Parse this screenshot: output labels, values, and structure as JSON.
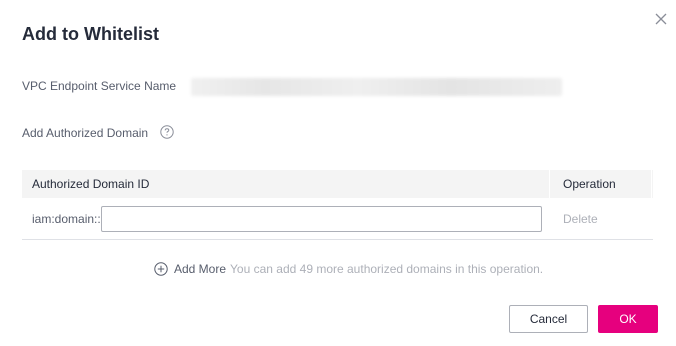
{
  "dialog": {
    "title": "Add to Whitelist"
  },
  "form": {
    "vpc_endpoint_label": "VPC Endpoint Service Name",
    "vpc_endpoint_value": "",
    "authorized_domain_label": "Add Authorized Domain"
  },
  "table": {
    "headers": [
      "Authorized Domain ID",
      "Operation"
    ],
    "rows": [
      {
        "prefix": "iam:domain::",
        "value": "",
        "action": "Delete"
      }
    ]
  },
  "add_more": {
    "link": "Add More",
    "hint": "You can add 49 more authorized domains in this operation."
  },
  "buttons": {
    "cancel": "Cancel",
    "ok": "OK"
  },
  "icons": {
    "close": "close-icon",
    "help": "question-circle-icon",
    "add": "plus-circle-icon"
  },
  "colors": {
    "primary": "#e6007e",
    "disabled_text": "#adb0b8",
    "header_bg": "#f4f4f4"
  }
}
